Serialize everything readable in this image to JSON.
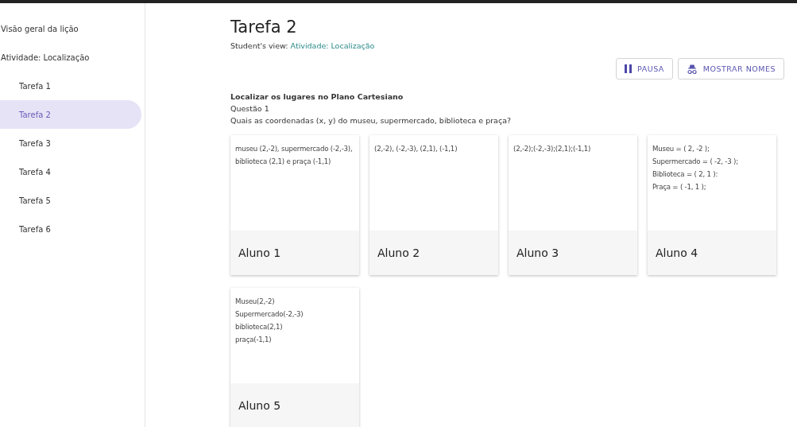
{
  "sidebar": {
    "items": [
      {
        "label": "Visão geral da lição",
        "selected": false
      },
      {
        "label": "Atividade: Localização",
        "selected": false,
        "children": [
          {
            "label": "Tarefa 1",
            "selected": false
          },
          {
            "label": "Tarefa 2",
            "selected": true
          },
          {
            "label": "Tarefa 3",
            "selected": false
          },
          {
            "label": "Tarefa 4",
            "selected": false
          },
          {
            "label": "Tarefa 5",
            "selected": false
          },
          {
            "label": "Tarefa 6",
            "selected": false
          }
        ]
      }
    ]
  },
  "main": {
    "title": "Tarefa 2",
    "view_label": "Student's view:",
    "view_link": "Atividade: Localização",
    "buttons": [
      {
        "kind": "pause",
        "label": "PAUSA"
      },
      {
        "kind": "names",
        "label": "MOSTRAR NOMES"
      }
    ],
    "question": {
      "heading": "Localizar os lugares no Plano Cartesiano",
      "number": "Questão 1",
      "text": "Quais as coordenadas (x, y) do museu, supermercado, biblioteca e praça?"
    },
    "answers": [
      {
        "lines": [
          "museu (2,-2), supermercado (-2,-3), biblioteca (2,1) e praça (-1,1)"
        ],
        "student": "Aluno 1"
      },
      {
        "lines": [
          "(2,-2), (-2,-3), (2,1), (-1,1)"
        ],
        "student": "Aluno 2"
      },
      {
        "lines": [
          "(2,-2);(-2,-3);(2,1);(-1,1)"
        ],
        "student": "Aluno 3"
      },
      {
        "lines": [
          "Museu = ( 2, -2 );",
          "Supermercado = ( -2, -3 );",
          "Biblioteca = ( 2, 1 ):",
          "Praça = ( -1, 1 );"
        ],
        "student": "Aluno 4"
      },
      {
        "lines": [
          "Museu(2,-2)",
          "Supermercado(-2,-3)",
          "biblioteca(2,1)",
          "praça(-1,1)"
        ],
        "student": "Aluno 5"
      }
    ]
  }
}
